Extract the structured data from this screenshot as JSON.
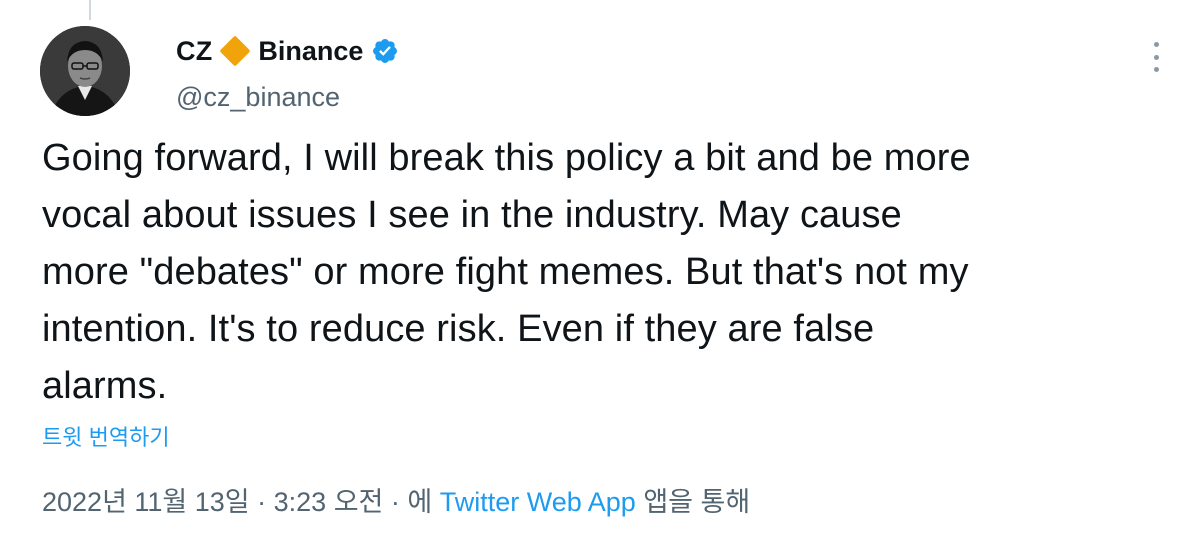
{
  "tweet": {
    "author": {
      "display_name": "CZ",
      "affiliation": "Binance",
      "handle": "@cz_binance",
      "verified": true,
      "badge_color": "#f0a30a",
      "verified_color": "#1d9bf0"
    },
    "text": "Going forward, I will break this policy a bit and be more\nvocal about issues I see in the industry. May cause\nmore \"debates\" or more fight memes. But that's not my\nintention. It's to reduce risk. Even if they are false\nalarms.",
    "translate_label": "트윗 번역하기",
    "timestamp": "2022년 11월 13일 · 3:23 오전 · ",
    "via_prefix": "에 ",
    "app_name": "Twitter Web App",
    "via_suffix": " 앱을 통해"
  },
  "icons": {
    "more": "more-vertical-icon",
    "verified": "verified-check-icon",
    "affiliation": "diamond-badge-icon"
  }
}
